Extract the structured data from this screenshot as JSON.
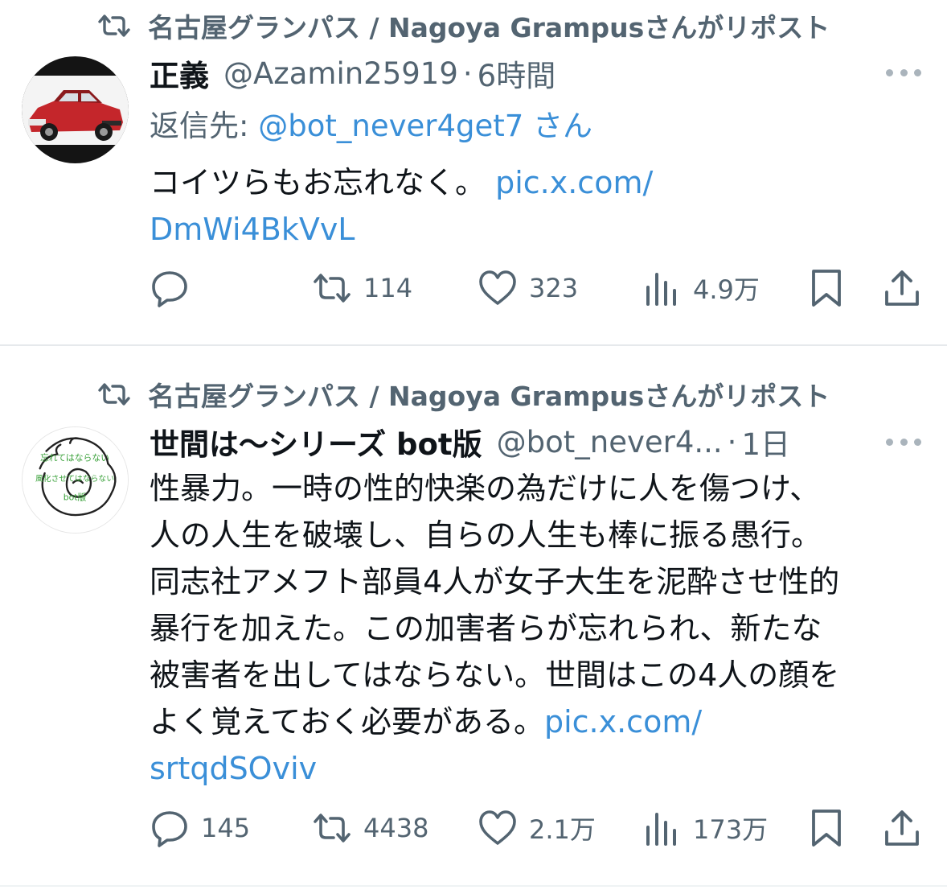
{
  "tweets": [
    {
      "reposted_by": "名古屋グランパス / Nagoya Grampusさんがリポスト",
      "name": "正義",
      "handle": "@Azamin25919",
      "dot": "·",
      "time": "6時間",
      "reply_prefix": "返信先: ",
      "reply_handle": "@bot_never4get7",
      "reply_suffix": " さん",
      "body_lines": [
        "コイツらもお忘れなく。 "
      ],
      "link_inline": "pic.x.com/",
      "link_next": "DmWi4BkVvL",
      "counts": {
        "replies": "",
        "reposts": "114",
        "likes": "323",
        "views": "4.9万"
      }
    },
    {
      "reposted_by": "名古屋グランパス / Nagoya Grampusさんがリポスト",
      "name": "世間は〜シリーズ bot版",
      "handle": "@bot_never4...",
      "dot": "·",
      "time": "1日",
      "avatar_text": [
        "忘れてはならない",
        "風化させてはならない",
        "bot版"
      ],
      "body_lines": [
        "性暴力。一時の性的快楽の為だけに人を傷つけ、",
        "人の人生を破壊し、自らの人生も棒に振る愚行。",
        "同志社アメフト部員4人が女子大生を泥酔させ性的",
        "暴行を加えた。この加害者らが忘れられ、新たな",
        "被害者を出してはならない。世間はこの4人の顔を",
        "よく覚えておく必要がある。"
      ],
      "link_inline": "pic.x.com/",
      "link_next": "srtqdSOviv",
      "counts": {
        "replies": "145",
        "reposts": "4438",
        "likes": "2.1万",
        "views": "173万"
      }
    }
  ],
  "icons": {
    "repost": "repost-icon",
    "reply": "reply-icon",
    "like": "heart-icon",
    "views": "views-icon",
    "bookmark": "bookmark-icon",
    "share": "share-icon",
    "more": "more-icon"
  },
  "colors": {
    "link": "#3a8fd8",
    "muted": "#536471",
    "text": "#0f1419"
  }
}
